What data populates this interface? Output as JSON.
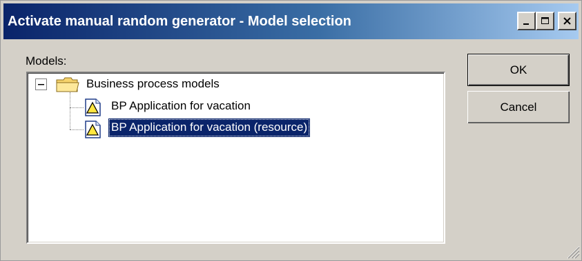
{
  "window": {
    "title": "Activate manual random generator - Model selection",
    "title_gradient": [
      "#0a246a",
      "#a6caf0"
    ],
    "controls": {
      "minimize_icon": "minimize-icon",
      "maximize_icon": "maximize-icon",
      "close_icon": "close-icon"
    }
  },
  "models": {
    "label": "Models:",
    "tree": {
      "root": {
        "label": "Business process models",
        "expanded": true,
        "icon": "folder-icon",
        "children": [
          {
            "label": "BP Application for vacation",
            "icon": "model-warning-icon",
            "selected": false
          },
          {
            "label": "BP Application for vacation (resource)",
            "icon": "model-warning-icon",
            "selected": true
          }
        ]
      }
    },
    "selection_color": "#0a246a"
  },
  "buttons": {
    "ok": "OK",
    "cancel": "Cancel"
  }
}
